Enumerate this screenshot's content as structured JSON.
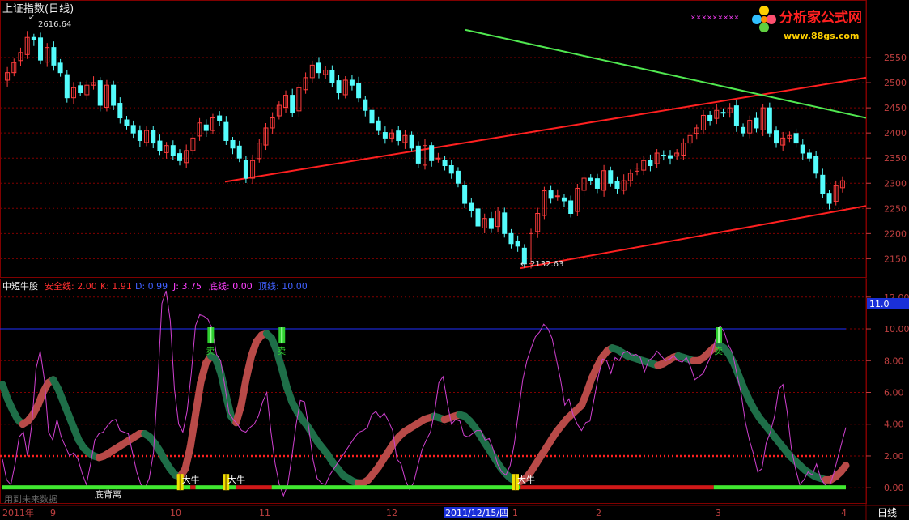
{
  "header": {
    "title": "上证指数(日线)",
    "watermark_logo": "分析家公式网",
    "watermark_url": "www.88gs.com",
    "watermark_marks": "×××××××××"
  },
  "chart_data": [
    {
      "type": "candlestick",
      "name": "上证指数",
      "period": "日线",
      "ylim": [
        2120,
        2600
      ],
      "y_ticks": [
        2150,
        2200,
        2250,
        2300,
        2350,
        2400,
        2450,
        2500,
        2550
      ],
      "high_marker": {
        "value": "2616.64",
        "label": "2616.64"
      },
      "low_marker": {
        "value": "2132.63",
        "label": "2132.63"
      },
      "colors": {
        "up": "#ff3c3c",
        "down": "#54fcfc"
      },
      "closes": [
        2520,
        2540,
        2560,
        2590,
        2585,
        2545,
        2570,
        2535,
        2520,
        2470,
        2490,
        2480,
        2495,
        2500,
        2455,
        2495,
        2455,
        2430,
        2415,
        2400,
        2385,
        2405,
        2380,
        2365,
        2375,
        2355,
        2345,
        2365,
        2390,
        2420,
        2405,
        2430,
        2425,
        2385,
        2370,
        2350,
        2310,
        2345,
        2380,
        2410,
        2430,
        2455,
        2475,
        2440,
        2490,
        2510,
        2535,
        2520,
        2525,
        2500,
        2480,
        2505,
        2495,
        2470,
        2445,
        2420,
        2405,
        2390,
        2400,
        2385,
        2395,
        2370,
        2340,
        2375,
        2345,
        2350,
        2335,
        2320,
        2300,
        2260,
        2245,
        2215,
        2230,
        2210,
        2245,
        2200,
        2180,
        2175,
        2140,
        2200,
        2240,
        2285,
        2270,
        2275,
        2265,
        2240,
        2290,
        2310,
        2305,
        2290,
        2325,
        2300,
        2290,
        2305,
        2320,
        2330,
        2345,
        2335,
        2360,
        2355,
        2350,
        2360,
        2380,
        2395,
        2410,
        2435,
        2425,
        2445,
        2440,
        2450,
        2415,
        2400,
        2425,
        2410,
        2450,
        2400,
        2380,
        2390,
        2395,
        2380,
        2360,
        2350,
        2320,
        2280,
        2260,
        2295,
        2305
      ],
      "channel_lines": [
        {
          "color": "#ff2020",
          "points": [
            [
              "2010-10-20",
              2303
            ],
            [
              "2011-04-11",
              2510
            ]
          ]
        },
        {
          "color": "#ff2020",
          "points": [
            [
              "2011-12-05",
              2131
            ],
            [
              "2011-04-11",
              2255
            ]
          ]
        },
        {
          "color": "#50e850",
          "points": [
            [
              "2011-10-24",
              2605
            ],
            [
              "2011-04-11",
              2430
            ]
          ]
        }
      ]
    },
    {
      "type": "line",
      "name": "中短牛股",
      "legend": [
        {
          "label": "安全线: 2.00",
          "color": "#ff3030"
        },
        {
          "label": "K: 1.91",
          "color": "#ff3030"
        },
        {
          "label": "D: 0.99",
          "color": "#4060ff"
        },
        {
          "label": "J: 3.75",
          "color": "#ff40ff"
        },
        {
          "label": "底线: 0.00",
          "color": "#ff40ff"
        },
        {
          "label": "顶线: 10.00",
          "color": "#4060ff"
        }
      ],
      "ylim": [
        -0.5,
        12.5
      ],
      "y_ticks": [
        "0.00",
        "2.00",
        "4.00",
        "6.00",
        "8.00",
        "10.00",
        "12.00"
      ],
      "current_value_tag": "11.0",
      "safe_line": 2,
      "top_line": 10,
      "j_line": [
        1.8,
        0.5,
        0.2,
        1.5,
        3.2,
        3.5,
        2.0,
        4.0,
        7.5,
        8.6,
        6.8,
        3.5,
        3.0,
        4.3,
        3.2,
        2.6,
        2.0,
        2.2,
        1.8,
        0.9,
        0.2,
        1.5,
        3.0,
        3.4,
        3.5,
        3.9,
        4.2,
        4.3,
        3.6,
        3.5,
        3.4,
        2.2,
        1.0,
        0.2,
        0.0,
        0.6,
        2.2,
        6.5,
        11.6,
        12.4,
        10.5,
        6.2,
        4.0,
        3.5,
        4.8,
        7.2,
        10.2,
        10.9,
        10.8,
        10.6,
        10.0,
        8.4,
        8.0,
        6.4,
        4.7,
        4.3,
        4.0,
        3.6,
        3.5,
        3.8,
        4.0,
        4.5,
        5.4,
        6.0,
        3.5,
        1.5,
        0.2,
        -0.5,
        0.2,
        2.0,
        4.0,
        5.5,
        5.4,
        3.8,
        1.8,
        0.6,
        0.3,
        0.2,
        0.8,
        1.2,
        1.6,
        2.0,
        2.4,
        2.8,
        3.2,
        3.5,
        3.6,
        3.8,
        4.6,
        4.8,
        4.4,
        4.7,
        4.2,
        3.6,
        1.8,
        1.5,
        0.5,
        -0.1,
        0.3,
        1.4,
        2.4,
        3.0,
        3.5,
        4.8,
        6.6,
        7.0,
        5.4,
        4.0,
        4.3,
        4.2,
        3.3,
        3.2,
        3.4,
        3.6,
        3.6,
        3.0,
        3.1,
        2.4,
        1.5,
        1.0,
        0.8,
        1.4,
        2.8,
        4.8,
        6.8,
        8.0,
        8.8,
        9.5,
        9.8,
        10.3,
        10.0,
        9.4,
        8.1,
        6.8,
        5.2,
        5.6,
        4.6,
        4.0,
        3.6,
        4.1,
        4.2,
        5.6,
        7.0,
        8.1,
        8.0,
        7.2,
        8.2,
        8.0,
        8.5,
        8.6,
        8.3,
        8.4,
        8.2,
        7.3,
        8.0,
        8.2,
        8.6,
        8.3,
        8.0,
        8.1,
        8.3,
        8.0,
        7.9,
        8.2,
        7.6,
        6.8,
        7.0,
        7.2,
        7.8,
        8.4,
        9.4,
        10.2,
        9.8,
        9.0,
        8.5,
        7.2,
        6.0,
        4.2,
        3.0,
        2.1,
        1.0,
        1.2,
        2.8,
        3.5,
        4.5,
        6.2,
        6.5,
        4.8,
        2.5,
        1.2,
        0.2,
        0.5,
        1.0,
        0.8,
        1.5,
        0.6,
        0.2,
        0.0,
        0.8,
        1.8,
        2.8,
        3.8
      ],
      "kd_ribbon": [
        6.5,
        5.6,
        4.9,
        4.3,
        4.0,
        4.2,
        4.6,
        5.2,
        6.0,
        6.6,
        6.8,
        6.2,
        5.4,
        4.6,
        3.8,
        3.0,
        2.5,
        2.2,
        2.0,
        1.9,
        2.0,
        2.2,
        2.4,
        2.6,
        2.8,
        3.0,
        3.2,
        3.4,
        3.4,
        3.2,
        2.8,
        2.3,
        1.7,
        1.2,
        0.8,
        0.7,
        1.2,
        2.6,
        4.6,
        6.6,
        7.8,
        8.3,
        8.1,
        7.2,
        5.8,
        4.5,
        4.1,
        5.2,
        6.9,
        8.3,
        9.2,
        9.6,
        9.7,
        9.4,
        8.6,
        7.5,
        6.3,
        5.4,
        4.8,
        4.3,
        3.9,
        3.4,
        2.9,
        2.5,
        2.1,
        1.6,
        1.2,
        0.8,
        0.6,
        0.4,
        0.3,
        0.3,
        0.5,
        0.9,
        1.3,
        1.8,
        2.3,
        2.8,
        3.2,
        3.5,
        3.7,
        3.9,
        4.1,
        4.3,
        4.4,
        4.5,
        4.4,
        4.3,
        4.4,
        4.5,
        4.6,
        4.5,
        4.2,
        3.8,
        3.3,
        2.8,
        2.3,
        1.8,
        1.3,
        0.9,
        0.6,
        0.4,
        0.4,
        0.6,
        1.0,
        1.5,
        2.0,
        2.5,
        3.0,
        3.5,
        3.9,
        4.3,
        4.6,
        4.9,
        5.2,
        6.0,
        6.9,
        7.6,
        8.2,
        8.6,
        8.8,
        8.7,
        8.5,
        8.3,
        8.2,
        8.1,
        8.0,
        7.9,
        7.8,
        7.7,
        7.8,
        8.0,
        8.2,
        8.3,
        8.2,
        8.1,
        8.0,
        8.0,
        8.2,
        8.5,
        8.8,
        9.0,
        8.8,
        8.4,
        7.8,
        7.0,
        6.2,
        5.5,
        4.9,
        4.4,
        4.0,
        3.6,
        3.2,
        2.8,
        2.4,
        2.0,
        1.7,
        1.4,
        1.1,
        0.9,
        0.7,
        0.6,
        0.5,
        0.5,
        0.7,
        1.0,
        1.4
      ]
    }
  ],
  "signals": {
    "sell_label": "卖",
    "buy_label": "大牛",
    "sell_marks": [
      {
        "k_index": 41
      },
      {
        "k_index": 55
      },
      {
        "k_index": 141
      }
    ],
    "buy_marks": [
      {
        "k_index": 35
      },
      {
        "k_index": 44
      },
      {
        "k_index": 101
      }
    ]
  },
  "status_bar": [
    {
      "state": "green",
      "from": 0,
      "to": 37
    },
    {
      "state": "red",
      "from": 37,
      "to": 38
    },
    {
      "state": "green",
      "from": 38,
      "to": 46
    },
    {
      "state": "red",
      "from": 46,
      "to": 53
    },
    {
      "state": "green",
      "from": 53,
      "to": 102
    },
    {
      "state": "red",
      "from": 102,
      "to": 140
    },
    {
      "state": "green",
      "from": 140,
      "to": 166
    }
  ],
  "annotations": {
    "future_data_note": "用到未来数据",
    "divergence_label": "底背离"
  },
  "x_axis": {
    "labels": [
      "2011年",
      "9",
      "10",
      "11",
      "12",
      "2011/12/15/四",
      "1",
      "2",
      "3",
      "4"
    ],
    "period_button": "日线"
  },
  "colors": {
    "grid": "#800000",
    "axis_text": "#c04040",
    "k_up": "#b84a48",
    "k_down": "#1e6e48",
    "status_green": "#40e830",
    "status_red": "#d01818",
    "safe_line": "#ff2020",
    "top_line": "#2030ff",
    "j_line": "#d040d0"
  }
}
